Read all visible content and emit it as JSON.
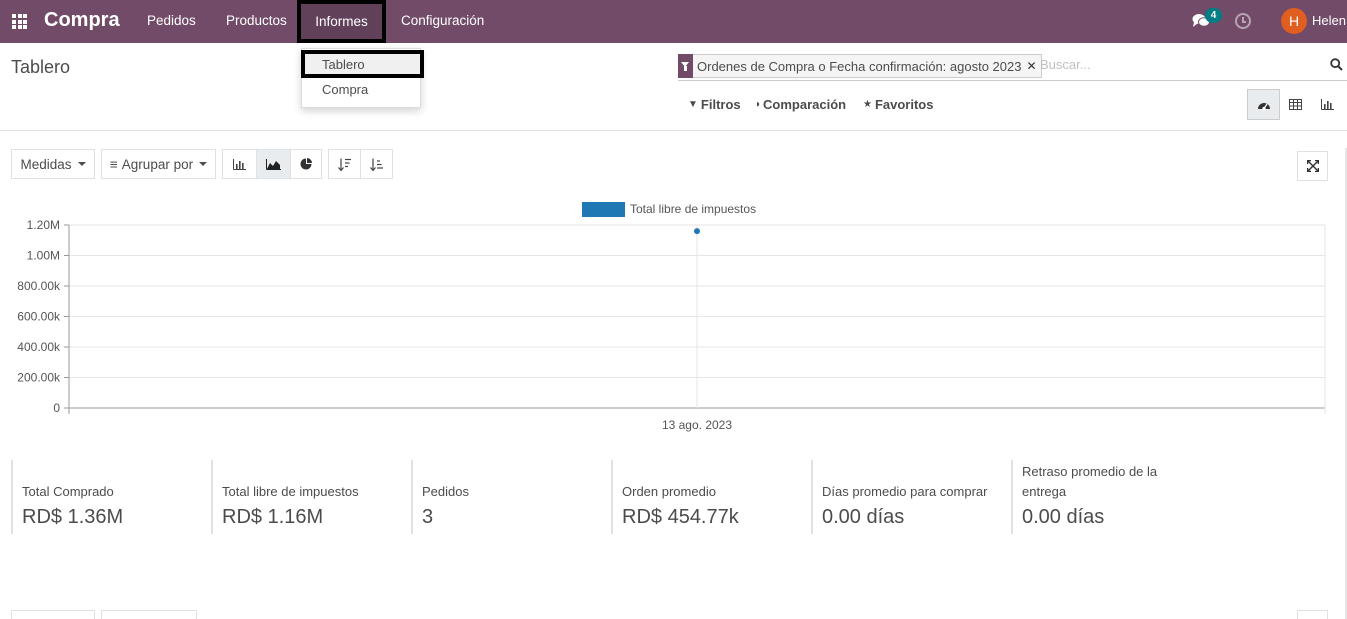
{
  "app": {
    "name": "Compra"
  },
  "nav": {
    "menu": [
      {
        "label": "Pedidos"
      },
      {
        "label": "Productos"
      },
      {
        "label": "Informes"
      },
      {
        "label": "Configuración"
      }
    ],
    "chat_count": "4",
    "user_initial": "H",
    "user_name": "Helen"
  },
  "dropdown": {
    "items": [
      "Tablero",
      "Compra"
    ]
  },
  "page": {
    "title": "Tablero"
  },
  "search": {
    "facet": "Ordenes de Compra o Fecha confirmación: agosto 2023",
    "placeholder": "Buscar..."
  },
  "filters": {
    "filtros": "Filtros",
    "comparacion": "Comparación",
    "favoritos": "Favoritos"
  },
  "toolbar": {
    "measures": "Medidas",
    "group_by": "Agrupar por"
  },
  "chart_data": {
    "type": "line",
    "series": [
      {
        "name": "Total libre de impuestos",
        "values": [
          1160000
        ]
      }
    ],
    "categories": [
      "13 ago. 2023"
    ],
    "y_ticks": [
      "1.20M",
      "1.00M",
      "800.00k",
      "600.00k",
      "400.00k",
      "200.00k",
      "0"
    ],
    "ylim": [
      0,
      1200000
    ],
    "legend_position": "top",
    "grid": true,
    "series_color": "#1f77b4"
  },
  "kpis": [
    {
      "label": "Total Comprado",
      "value": "RD$ 1.36M"
    },
    {
      "label": "Total libre de impuestos",
      "value": "RD$ 1.16M"
    },
    {
      "label": "Pedidos",
      "value": "3"
    },
    {
      "label": "Orden promedio",
      "value": "RD$ 454.77k"
    },
    {
      "label": "Días promedio para comprar",
      "value": "0.00 días"
    },
    {
      "label": "Retraso promedio de la entrega",
      "value": "0.00 días"
    }
  ]
}
